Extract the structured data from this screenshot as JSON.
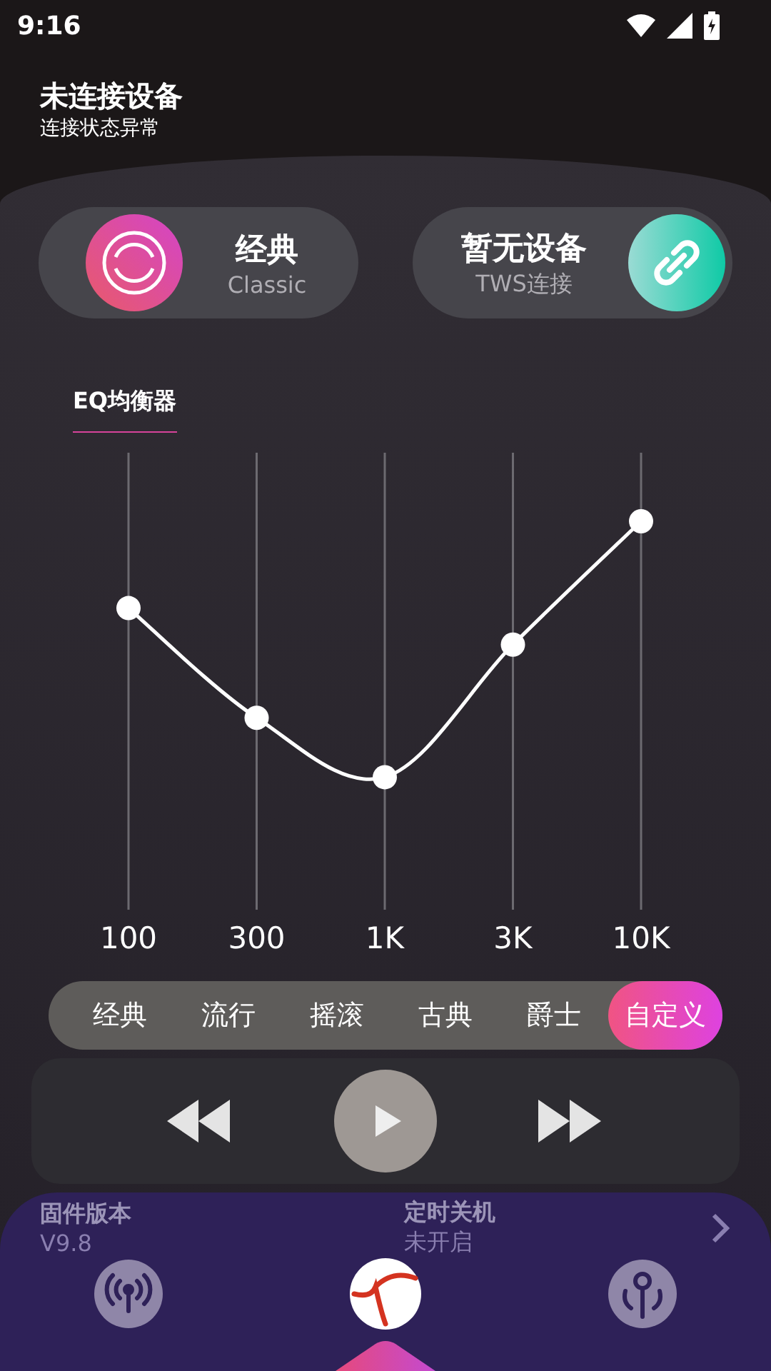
{
  "status_bar": {
    "time": "9:16"
  },
  "header": {
    "title": "未连接设备",
    "subtitle": "连接状态异常"
  },
  "mode_cards": [
    {
      "kind": "sound",
      "title": "经典",
      "subtitle": "Classic"
    },
    {
      "kind": "device",
      "title": "暂无设备",
      "subtitle": "TWS连接"
    }
  ],
  "section_tab": {
    "label": "EQ均衡器"
  },
  "eq": {
    "bands": [
      {
        "label": "100",
        "level": 0.66
      },
      {
        "label": "300",
        "level": 0.42
      },
      {
        "label": "1K",
        "level": 0.29
      },
      {
        "label": "3K",
        "level": 0.58
      },
      {
        "label": "10K",
        "level": 0.85
      }
    ]
  },
  "presets": [
    {
      "label": "经典",
      "selected": false
    },
    {
      "label": "流行",
      "selected": false
    },
    {
      "label": "摇滚",
      "selected": false
    },
    {
      "label": "古典",
      "selected": false
    },
    {
      "label": "爵士",
      "selected": false
    },
    {
      "label": "自定义",
      "selected": true
    }
  ],
  "info": [
    {
      "title": "固件版本",
      "value": "V9.8"
    },
    {
      "title": "定时关机",
      "value": "未开启"
    }
  ]
}
